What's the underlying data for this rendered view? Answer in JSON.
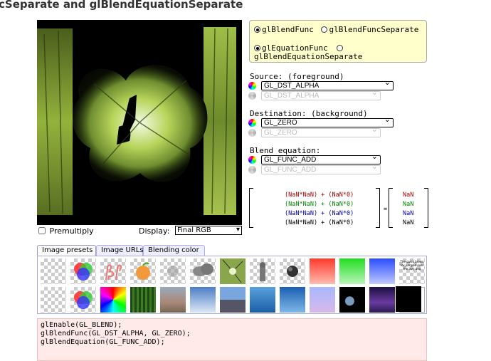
{
  "page": {
    "title": "cSeparate and glBlendEquationSeparate"
  },
  "func_options": {
    "blend_func": "glBlendFunc",
    "blend_func_separate": "glBlendFuncSeparate",
    "equation_func": "glEquationFunc",
    "blend_equation_separate": "glBlendEquationSeparate",
    "selected_func": "glBlendFunc",
    "selected_equation": "glEquationFunc"
  },
  "source": {
    "label": "Source: (foreground)",
    "rgb_value": "GL_DST_ALPHA",
    "alpha_value": "GL_DST_ALPHA"
  },
  "destination": {
    "label": "Destination: (background)",
    "rgb_value": "GL_ZERO",
    "alpha_value": "GL_ZERO"
  },
  "equation": {
    "label": "Blend equation:",
    "rgb_value": "GL_FUNC_ADD",
    "alpha_value": "GL_FUNC_ADD"
  },
  "formula": {
    "lines": [
      {
        "text": "(NaN*NaN) + (NaN*0)",
        "color": "#aa0000"
      },
      {
        "text": "(NaN*NaN) + (NaN*0)",
        "color": "#008800"
      },
      {
        "text": "(NaN*NaN) + (NaN*0)",
        "color": "#0000aa"
      },
      {
        "text": "(NaN*NaN) + (NaN*0)",
        "color": "#000000"
      }
    ],
    "equals": "=",
    "results": [
      {
        "text": "NaN",
        "color": "#aa0000"
      },
      {
        "text": "NaN",
        "color": "#008800"
      },
      {
        "text": "NaN",
        "color": "#0000aa"
      },
      {
        "text": "NaN",
        "color": "#000000"
      }
    ]
  },
  "controls": {
    "premultiply_label": "Premultiply",
    "premultiply_checked": false,
    "display_label": "Display:",
    "display_value": "Final RGB"
  },
  "tabs": [
    "Image presets",
    "Image URLs",
    "Blending color"
  ],
  "thumbnail_text": "The quick brown fox jumped over the lazy dog",
  "code": [
    "glEnable(GL_BLEND);",
    "glBlendFunc(GL_DST_ALPHA, GL_ZERO);",
    "glBlendEquation(GL_FUNC_ADD);"
  ]
}
